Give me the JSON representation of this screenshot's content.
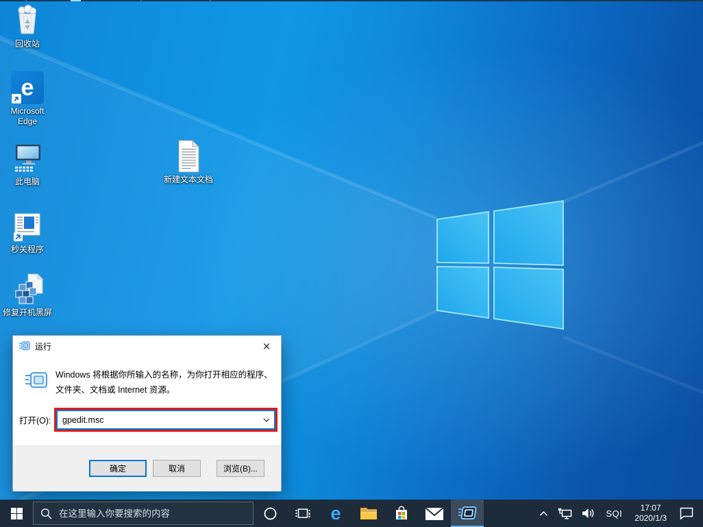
{
  "colors": {
    "accent": "#0078d7",
    "highlight_red": "#e01b1b",
    "taskbar_bg": "#1d2b3a",
    "wallpaper_light": "#1197e6",
    "wallpaper_dark": "#0a4da2",
    "active_app_underline": "#6ab1e8"
  },
  "desktop": {
    "icons": [
      {
        "name": "recycle-bin",
        "label": "回收站"
      },
      {
        "name": "microsoft-edge",
        "label": "Microsoft Edge"
      },
      {
        "name": "this-pc",
        "label": "此电脑"
      },
      {
        "name": "app-shortcut",
        "label": "秒关程序"
      },
      {
        "name": "registry-fix",
        "label": "修复开机黑屏"
      },
      {
        "name": "text-document",
        "label": "新建文本文档"
      }
    ]
  },
  "run_dialog": {
    "title": "运行",
    "close_glyph": "×",
    "description_lines": [
      "Windows 将根据你所输入的名称，为你打开相应的程序、",
      "文件夹、文档或 Internet 资源。"
    ],
    "open_label": "打开(O):",
    "input_value": "gpedit.msc",
    "ok_label": "确定",
    "cancel_label": "取消",
    "browse_label": "浏览(B)..."
  },
  "taskbar": {
    "search_placeholder": "在这里输入你要搜索的内容",
    "tray": {
      "ime_label": "SQI",
      "time": "17:07",
      "date": "2020/1/3"
    }
  },
  "icons": [
    "start-icon",
    "search-icon",
    "cortana-icon",
    "task-view-icon",
    "edge-icon",
    "file-explorer-icon",
    "store-icon",
    "mail-icon",
    "run-app-icon",
    "tray-chevron-up-icon",
    "network-icon",
    "volume-icon",
    "action-center-icon",
    "close-icon",
    "dropdown-chevron-icon",
    "run-dialog-icon",
    "windows-logo"
  ]
}
